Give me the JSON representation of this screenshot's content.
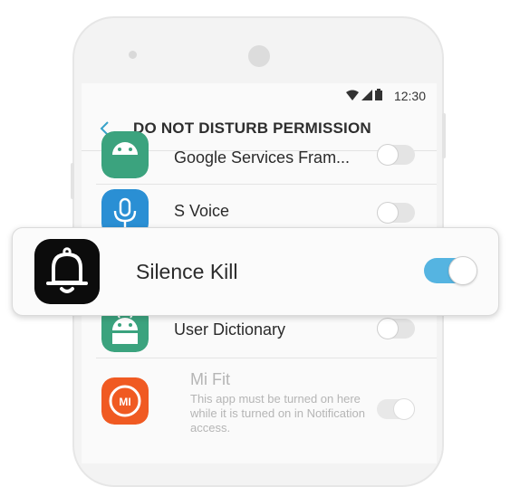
{
  "status_bar": {
    "time": "12:30",
    "icons": [
      "wifi-icon",
      "signal-icon",
      "battery-icon"
    ]
  },
  "app_bar": {
    "title": "DO NOT DISTURB PERMISSION",
    "back_icon": "chevron-left-icon"
  },
  "apps": [
    {
      "name": "Google Services Fram...",
      "icon": "android-icon",
      "enabled": false
    },
    {
      "name": "S Voice",
      "icon": "microphone-icon",
      "enabled": false
    },
    {
      "name": "User Dictionary",
      "icon": "android-icon",
      "enabled": false
    },
    {
      "name": "Mi Fit",
      "icon": "mi-logo-icon",
      "enabled": true,
      "disabled": true,
      "description": "This app must be turned on here while it is turned on in Notification access."
    }
  ],
  "highlight": {
    "name": "Silence Kill",
    "icon": "bell-icon",
    "enabled": true
  },
  "colors": {
    "accent": "#37a2c9",
    "toggle_on": "#55b4e1",
    "android_green": "#3ba37e",
    "voice_blue": "#2a8fd4",
    "mi_orange": "#f05a22"
  }
}
